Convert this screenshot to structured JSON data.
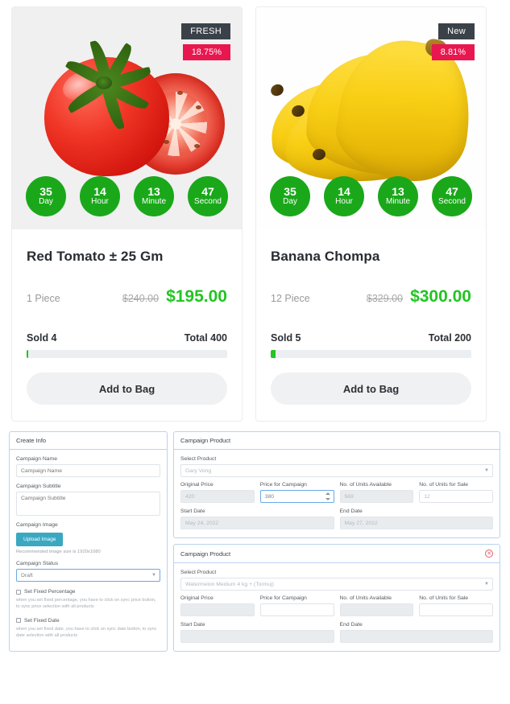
{
  "products": [
    {
      "badge_tag": "FRESH",
      "badge_discount": "18.75%",
      "image": "tomato-image",
      "countdown": [
        {
          "value": "35",
          "label": "Day"
        },
        {
          "value": "14",
          "label": "Hour"
        },
        {
          "value": "13",
          "label": "Minute"
        },
        {
          "value": "47",
          "label": "Second"
        }
      ],
      "title": "Red Tomato ± 25 Gm",
      "unit": "1 Piece",
      "old_price": "$240.00",
      "new_price": "$195.00",
      "sold": "Sold 4",
      "total": "Total 400",
      "progress_percent": 1,
      "action": "Add to Bag"
    },
    {
      "badge_tag": "New",
      "badge_discount": "8.81%",
      "image": "banana-image",
      "countdown": [
        {
          "value": "35",
          "label": "Day"
        },
        {
          "value": "14",
          "label": "Hour"
        },
        {
          "value": "13",
          "label": "Minute"
        },
        {
          "value": "47",
          "label": "Second"
        }
      ],
      "title": "Banana Chompa",
      "unit": "12 Piece",
      "old_price": "$329.00",
      "new_price": "$300.00",
      "sold": "Sold 5",
      "total": "Total 200",
      "progress_percent": 2.5,
      "action": "Add to Bag"
    }
  ],
  "create_info": {
    "title": "Create Info",
    "campaign_name_label": "Campaign Name",
    "campaign_name_placeholder": "Campaign Name",
    "campaign_name_value": "",
    "campaign_subtitle_label": "Campaign Subtitle",
    "campaign_subtitle_placeholder": "Campaign Subtitle",
    "campaign_subtitle_value": "",
    "campaign_image_label": "Campaign Image",
    "upload_button": "Upload Image",
    "image_hint": "Recommended image size is 1920x1080",
    "campaign_status_label": "Campaign Status",
    "campaign_status_value": "Draft",
    "fixed_percentage_label": "Set Fixed Percentage",
    "fixed_percentage_help": "when you set fixed percentage, you have to click on sync price button, to sync price selection with all products",
    "fixed_date_label": "Set Fixed Date",
    "fixed_date_help": "when you set fixed date, you have to click on sync date button, to sync date selection with all products"
  },
  "campaign_products": [
    {
      "title": "Campaign Product",
      "has_close": false,
      "select_product_label": "Select Product",
      "select_product_value": "Gary Vong",
      "original_price_label": "Original Price",
      "original_price_value": "420",
      "price_campaign_label": "Price for Campaign",
      "price_campaign_value": "380",
      "units_available_label": "No. of Units Available",
      "units_available_value": "569",
      "units_for_sale_label": "No. of Units for Sale",
      "units_for_sale_value": "12",
      "start_date_label": "Start Date",
      "start_date_value": "May 24, 2022",
      "end_date_label": "End Date",
      "end_date_value": "May 27, 2022"
    },
    {
      "title": "Campaign Product",
      "has_close": true,
      "close_label": "✕",
      "select_product_label": "Select Product",
      "select_product_value": "Watermelon Medium 4 kg + (Tormuj)",
      "original_price_label": "Original Price",
      "original_price_value": "",
      "price_campaign_label": "Price for Campaign",
      "price_campaign_value": "",
      "units_available_label": "No. of Units Available",
      "units_available_value": "",
      "units_for_sale_label": "No. of Units for Sale",
      "units_for_sale_value": "",
      "start_date_label": "Start Date",
      "start_date_value": "",
      "end_date_label": "End Date",
      "end_date_value": ""
    }
  ],
  "colors": {
    "green": "#22c522",
    "countdown_green": "#1aa81a",
    "badge_dark": "#3a4149",
    "badge_pink": "#e8174f",
    "upload_teal": "#3aa8c1",
    "panel_border": "#b9d3ef",
    "close_red": "#e45c6a"
  }
}
